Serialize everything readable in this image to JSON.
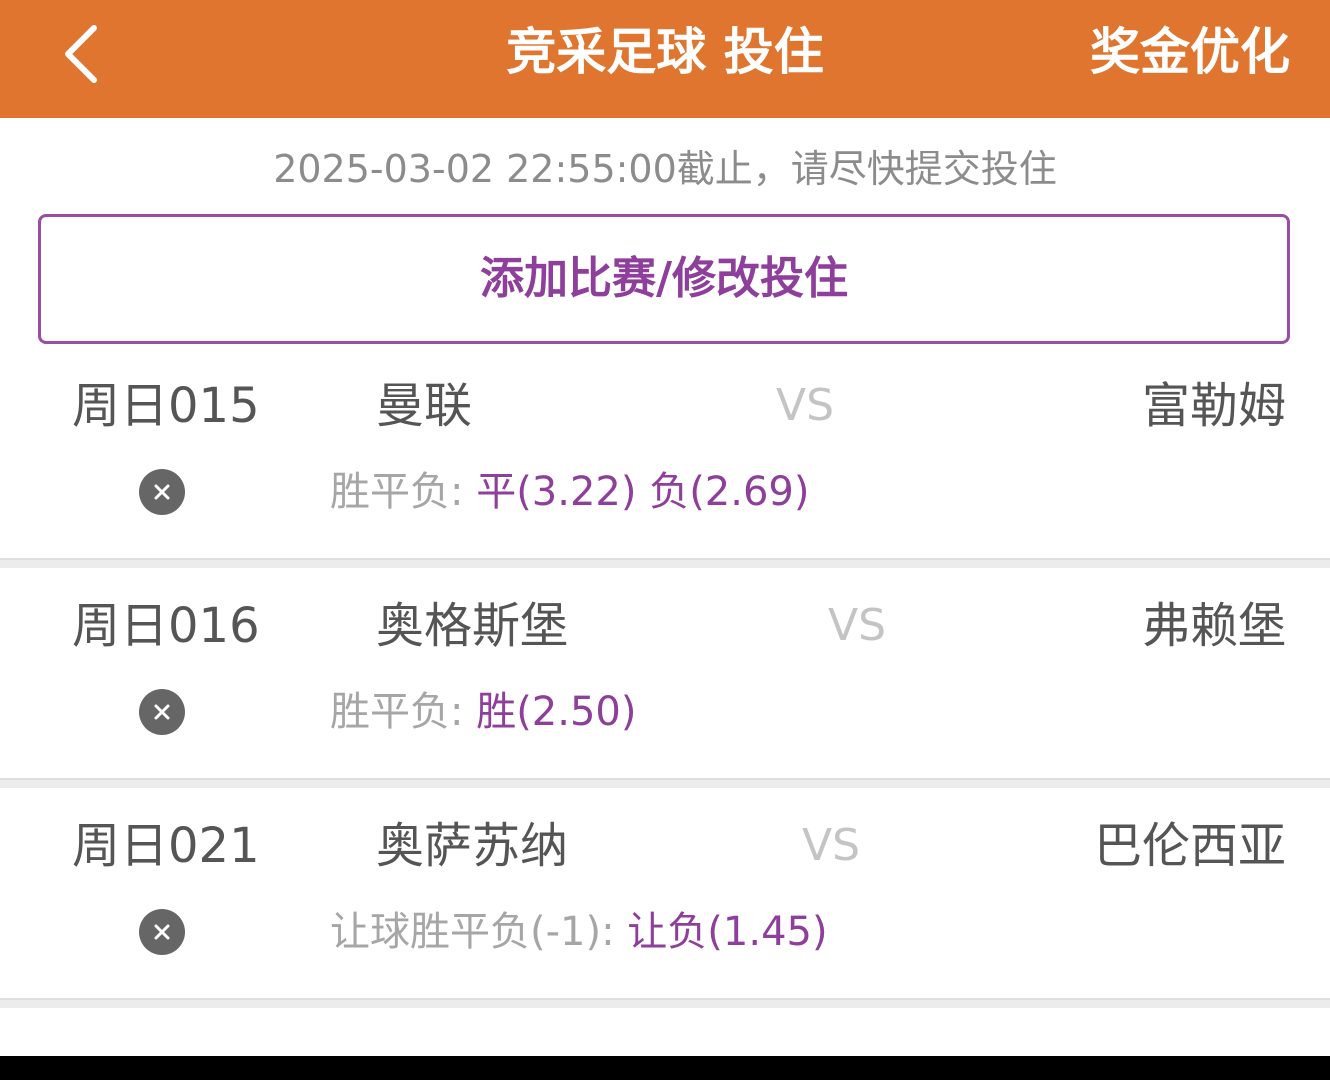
{
  "header": {
    "title": "竞采足球 投住",
    "action": "奖金优化",
    "back_icon": "chevron-left-icon",
    "color": "#e07530"
  },
  "deadline": "2025-03-02 22:55:00截止，请尽快提交投住",
  "add_button": "添加比赛/修改投住",
  "matches": [
    {
      "code": "周日015",
      "home": "曼联",
      "vs": "VS",
      "away": "富勒姆",
      "bet_type": "胜平负:",
      "bet_pick": "平(3.22) 负(2.69)"
    },
    {
      "code": "周日016",
      "home": "奥格斯堡",
      "vs": "VS",
      "away": "弗赖堡",
      "bet_type": "胜平负:",
      "bet_pick": "胜(2.50)"
    },
    {
      "code": "周日021",
      "home": "奥萨苏纳",
      "vs": "VS",
      "away": "巴伦西亚",
      "bet_type": "让球胜平负(-1):",
      "bet_pick": "让负(1.45)"
    }
  ],
  "colors": {
    "accent": "#e07530",
    "pick": "#8e3e9b",
    "muted": "#a6a6a6"
  }
}
